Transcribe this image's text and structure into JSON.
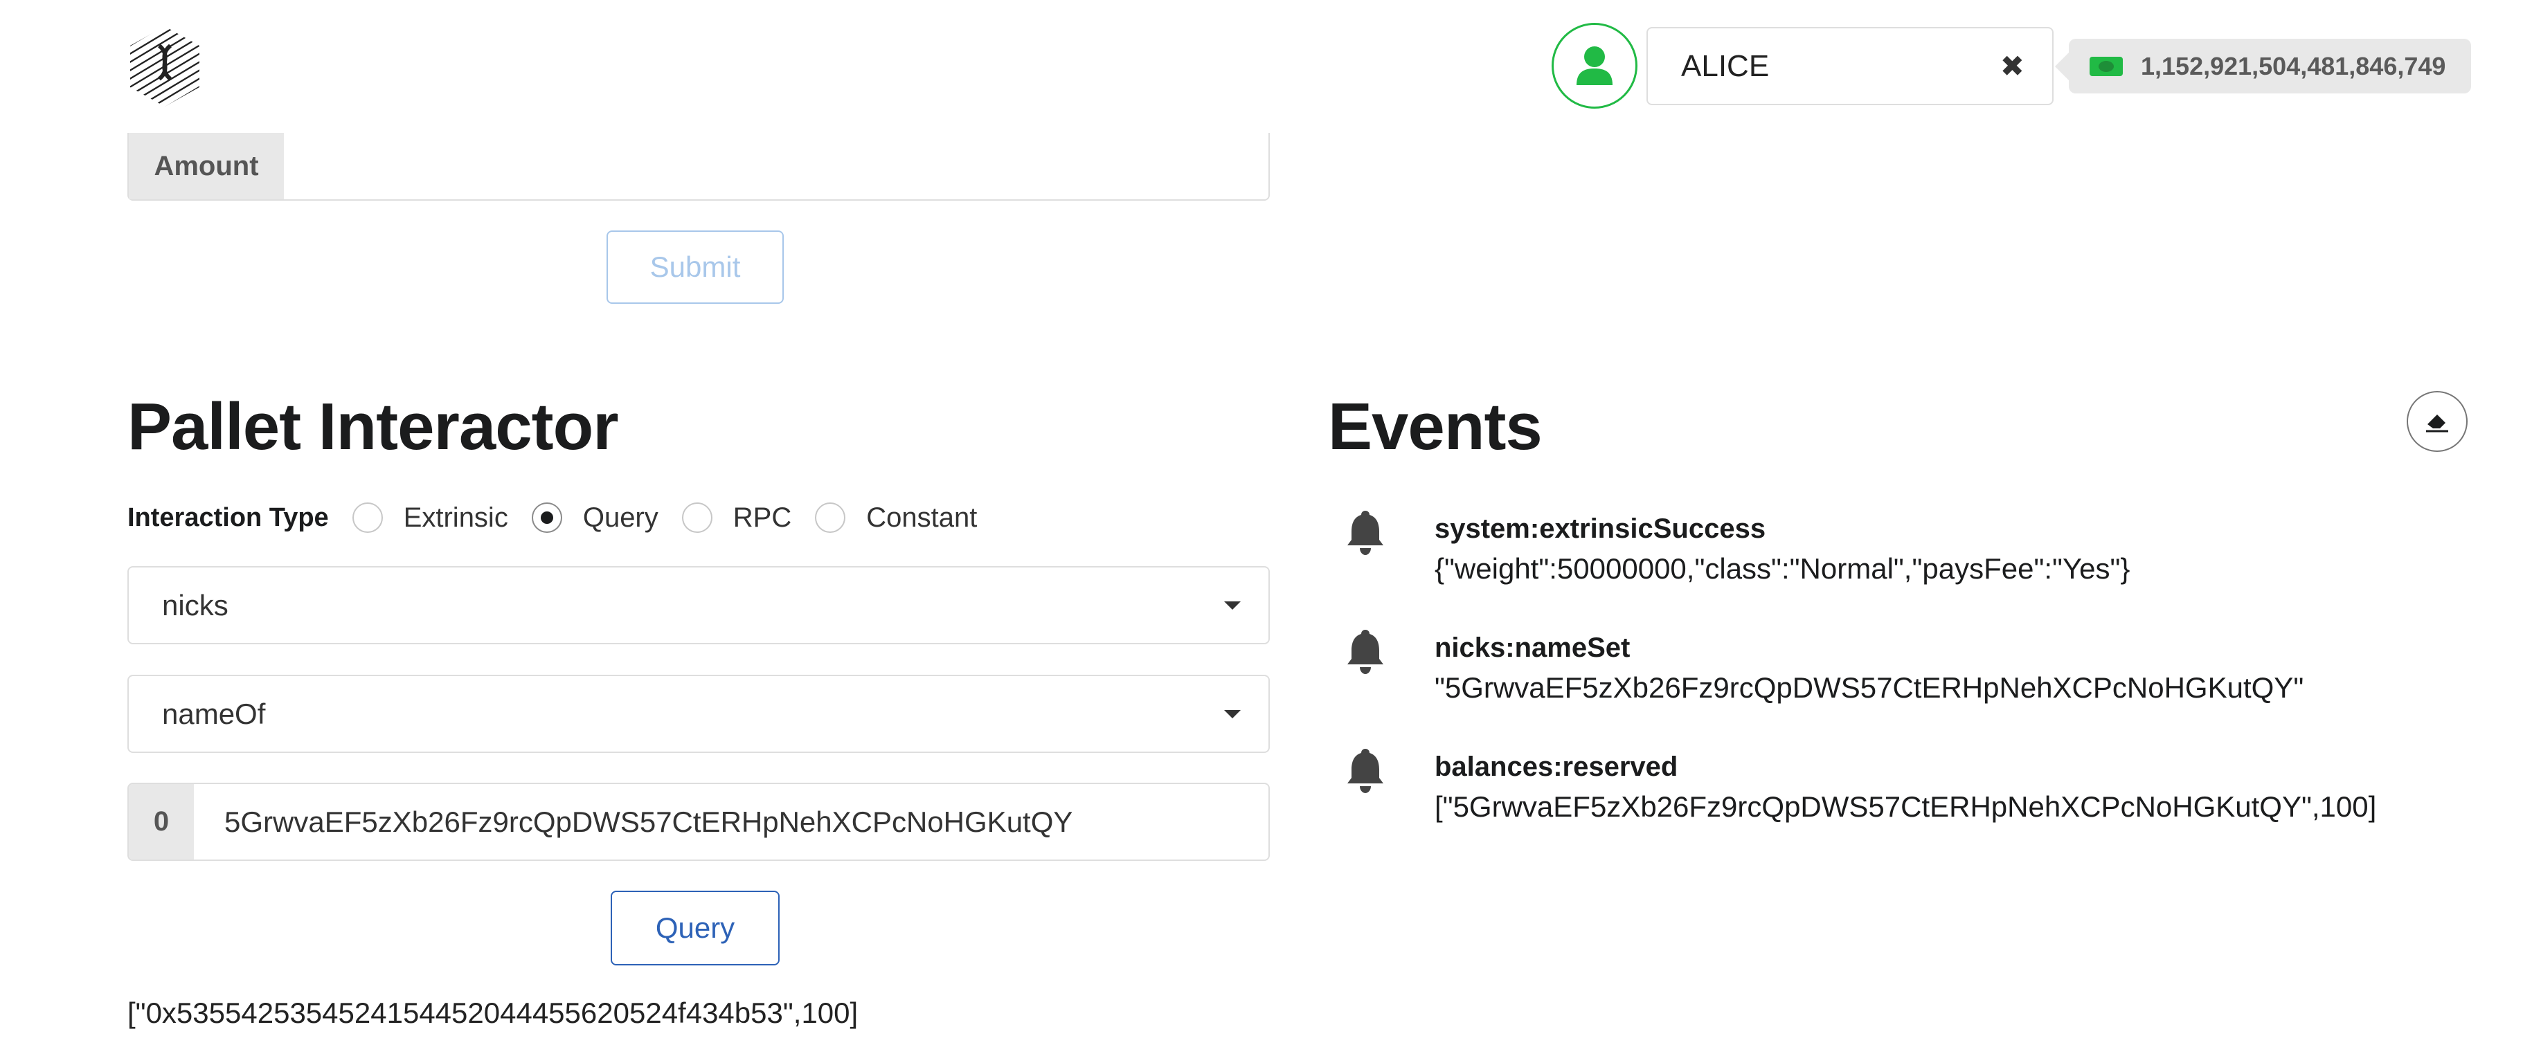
{
  "header": {
    "logo_icon": "hatched-hexagon-logo-icon",
    "avatar_icon": "user-icon",
    "account_name": "ALICE",
    "clear_icon": "close-icon",
    "balance_icon": "money-bill-icon",
    "balance": "1,152,921,504,481,846,749"
  },
  "transfer": {
    "amount_label": "Amount",
    "amount_value": "",
    "submit_label": "Submit"
  },
  "pallet_interactor": {
    "title": "Pallet Interactor",
    "interaction_type_label": "Interaction Type",
    "interaction_types": [
      {
        "label": "Extrinsic",
        "checked": false
      },
      {
        "label": "Query",
        "checked": true
      },
      {
        "label": "RPC",
        "checked": false
      },
      {
        "label": "Constant",
        "checked": false
      }
    ],
    "pallet_value": "nicks",
    "callable_value": "nameOf",
    "param_label": "0",
    "param_value": "5GrwvaEF5zXb26Fz9rcQpDWS57CtERHpNehXCPcNoHGKutQY",
    "query_label": "Query",
    "result": "[\"0x5355425354524154452044455620524f434b53\",100]"
  },
  "events": {
    "title": "Events",
    "clear_icon": "eraser-icon",
    "items": [
      {
        "icon": "bell-icon",
        "title": "system:extrinsicSuccess",
        "data": "{\"weight\":50000000,\"class\":\"Normal\",\"paysFee\":\"Yes\"}"
      },
      {
        "icon": "bell-icon",
        "title": "nicks:nameSet",
        "data": "\"5GrwvaEF5zXb26Fz9rcQpDWS57CtERHpNehXCPcNoHGKutQY\""
      },
      {
        "icon": "bell-icon",
        "title": "balances:reserved",
        "data": "[\"5GrwvaEF5zXb26Fz9rcQpDWS57CtERHpNehXCPcNoHGKutQY\",100]"
      }
    ]
  },
  "colors": {
    "avatar_border": "#21ba45",
    "primary_button": "#2d62b7",
    "disabled_button": "#a8c7ea",
    "label_bg": "#e8e8e8"
  }
}
